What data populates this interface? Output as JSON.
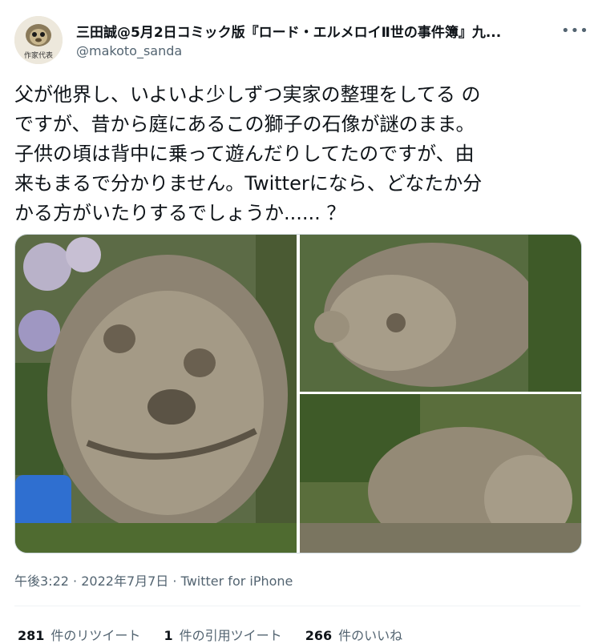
{
  "author": {
    "display_name": "三田誠@5月2日コミック版『ロード・エルメロイⅡ世の事件簿』九...",
    "handle": "@makoto_sanda",
    "avatar_label": "作家代表"
  },
  "more_icon": "more-horizontal-icon",
  "tweet": {
    "text": "父が他界し、いよいよ少しずつ実家の整理をしてる の\nですが、昔から庭にあるこの獅子の石像が謎のまま。\n子供の頃は背中に乗って遊んだりしてたのですが、由\n来もまるで分かりません。Twitterになら、どなたか分\nかる方がいたりするでしょうか...... ？"
  },
  "timestamp": {
    "time": "午後3:22",
    "date": "2022年7月7日",
    "source": "Twitter for iPhone",
    "separator": "·"
  },
  "stats": {
    "retweets_count": "281",
    "retweets_label": "件のリツイート",
    "quotes_count": "1",
    "quotes_label": "件の引用ツイート",
    "likes_count": "266",
    "likes_label": "件のいいね"
  },
  "colors": {
    "text": "#0f1419",
    "secondary": "#536471",
    "border": "#cfd9de"
  }
}
